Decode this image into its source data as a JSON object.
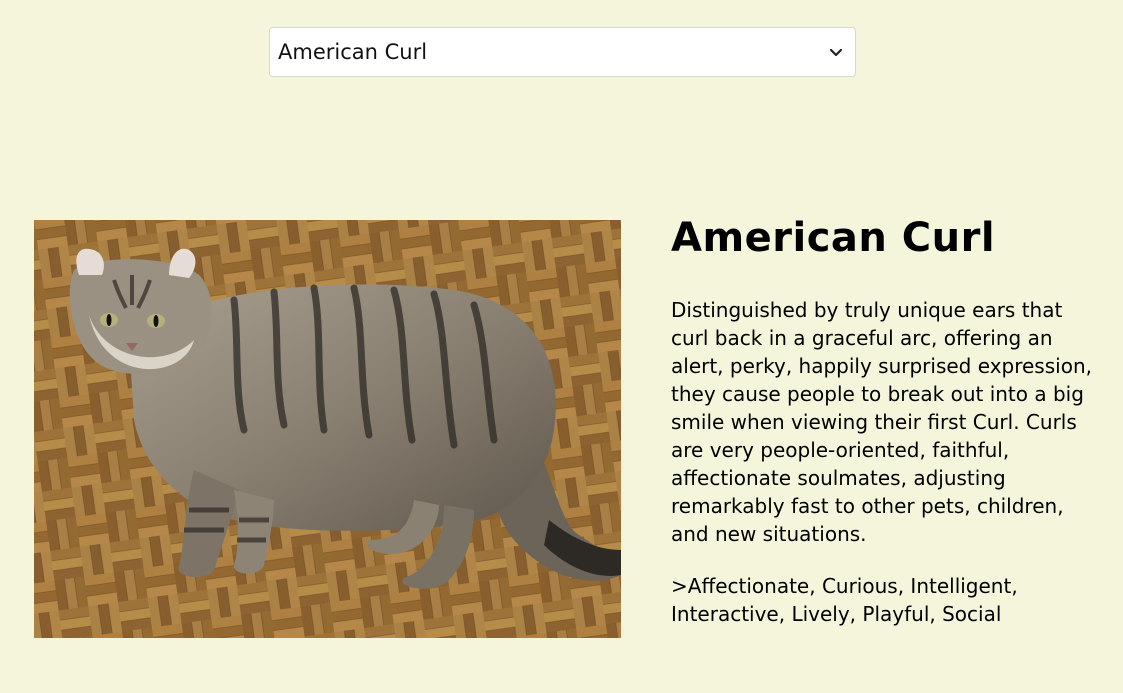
{
  "breed_select": {
    "selected": "American Curl",
    "icon": "chevron-down-icon"
  },
  "breed": {
    "name": "American Curl",
    "description": "Distinguished by truly unique ears that curl back in a graceful arc, offering an alert, perky, happily surprised expression, they cause people to break out into a big smile when viewing their first Curl. Curls are very people-oriented, faithful, affectionate soulmates, adjusting remarkably fast to other pets, children, and new situations.",
    "temperament": ">Affectionate, Curious, Intelligent, Interactive, Lively, Playful, Social"
  },
  "colors": {
    "background": "#f5f5dc",
    "select_background": "#ffffff"
  }
}
